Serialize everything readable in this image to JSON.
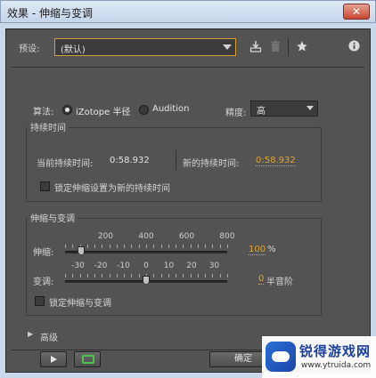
{
  "window": {
    "title": "效果 - 伸缩与变调",
    "close_icon": "close-icon"
  },
  "preset": {
    "label": "预设:",
    "value": "(默认)",
    "icons": [
      "save-preset-icon",
      "delete-preset-icon",
      "favorite-star-icon",
      "info-icon"
    ]
  },
  "algorithm": {
    "label": "算法:",
    "options": [
      {
        "label": "iZotope 半径",
        "selected": true
      },
      {
        "label": "Audition",
        "selected": false
      }
    ],
    "precision_label": "精度:",
    "precision_value": "高"
  },
  "duration": {
    "group_title": "持续时间",
    "current_label": "当前持续时间:",
    "current_value": "0:58.932",
    "new_label": "新的持续时间:",
    "new_value": "0:58.932",
    "lock_label": "锁定伸缩设置为新的持续时间"
  },
  "stretch_pitch": {
    "group_title": "伸缩与变调",
    "stretch": {
      "label": "伸缩:",
      "ticks": [
        "200",
        "400",
        "600",
        "800"
      ],
      "value": "100",
      "unit": "%",
      "position": 0.1
    },
    "pitch": {
      "label": "变调:",
      "ticks": [
        "-30",
        "-20",
        "-10",
        "0",
        "10",
        "20",
        "30"
      ],
      "value": "0",
      "unit": "半音阶",
      "position": 0.5
    },
    "lock_label": "锁定伸缩与变调"
  },
  "advanced": {
    "label": "高级"
  },
  "footer": {
    "ok_label": "确定"
  },
  "watermark": {
    "title": "锐得游戏网",
    "url": "www.ytruida.com"
  },
  "colors": {
    "accent": "#e0a430",
    "panel": "#535353",
    "loop_green": "#4fc24f"
  }
}
